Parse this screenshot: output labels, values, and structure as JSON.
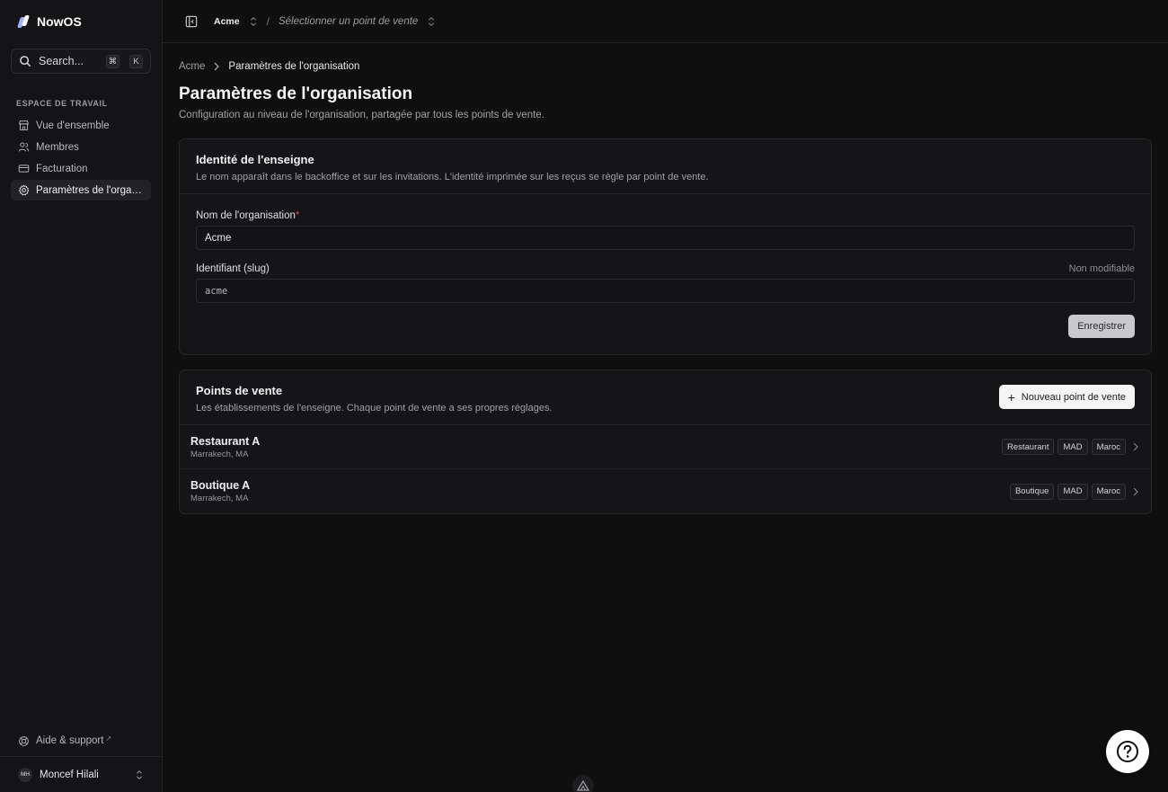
{
  "brand": {
    "name": "NowOS"
  },
  "search": {
    "label": "Search...",
    "kbd1": "⌘",
    "kbd2": "K"
  },
  "sidebar": {
    "section_label": "ESPACE DE TRAVAIL",
    "items": [
      {
        "label": "Vue d'ensemble",
        "icon": "store-icon"
      },
      {
        "label": "Membres",
        "icon": "users-icon"
      },
      {
        "label": "Facturation",
        "icon": "card-icon"
      },
      {
        "label": "Paramètres de l'organ...",
        "icon": "gear-icon"
      }
    ],
    "help": "Aide & support",
    "user": {
      "initials": "MH",
      "name": "Moncef Hilali"
    }
  },
  "topbar": {
    "org": "Acme",
    "separator": "/",
    "store_placeholder": "Sélectionner un point de vente"
  },
  "breadcrumb": {
    "root": "Acme",
    "current": "Paramètres de l'organisation"
  },
  "page": {
    "title": "Paramètres de l'organisation",
    "subtitle": "Configuration au niveau de l'organisation, partagée par tous les points de vente."
  },
  "identity": {
    "title": "Identité de l'enseigne",
    "description": "Le nom apparaît dans le backoffice et sur les invitations. L'identité imprimée sur les reçus se règle par point de vente.",
    "name_label": "Nom de l'organisation",
    "required_mark": "*",
    "name_value": "Acme",
    "slug_label": "Identifiant (slug)",
    "slug_note": "Non modifiable",
    "slug_value": "acme",
    "save_label": "Enregistrer"
  },
  "pos": {
    "title": "Points de vente",
    "description": "Les établissements de l'enseigne. Chaque point de vente a ses propres réglages.",
    "new_label": "Nouveau point de vente",
    "rows": [
      {
        "name": "Restaurant A",
        "location": "Marrakech, MA",
        "tags": [
          "Restaurant",
          "MAD",
          "Maroc"
        ]
      },
      {
        "name": "Boutique A",
        "location": "Marrakech, MA",
        "tags": [
          "Boutique",
          "MAD",
          "Maroc"
        ]
      }
    ]
  }
}
